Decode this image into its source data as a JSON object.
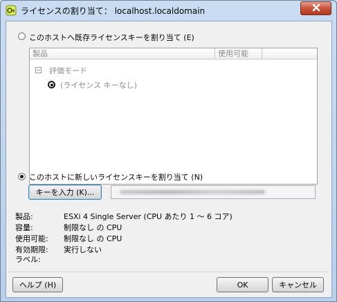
{
  "window": {
    "title": "ライセンスの割り当て： localhost.localdomain",
    "icons": {
      "app": "license-key-icon",
      "close": "close-icon"
    }
  },
  "existing_option": {
    "label": "このホストへ既存ライセンスキーを割り当て (E)",
    "selected": false
  },
  "license_table": {
    "columns": [
      "製品",
      "使用可能"
    ],
    "groups": [
      {
        "name": "評価モード",
        "expanded": true,
        "items": [
          {
            "label": "(ライセンス キーなし)",
            "selected": true
          }
        ]
      }
    ]
  },
  "new_option": {
    "label": "このホストに新しいライセンスキーを割り当て (N)",
    "selected": true,
    "enter_key_button": "キーを入力 (K)..."
  },
  "details": {
    "product_label": "製品:",
    "product_value": "ESXi 4 Single Server (CPU あたり 1 〜 6 コア)",
    "capacity_label": "容量:",
    "capacity_value": "制限なし の CPU",
    "available_label": "使用可能:",
    "available_value": "制限なし の CPU",
    "expiry_label": "有効期限:",
    "expiry_value": "実行しない",
    "labels_label": "ラベル:"
  },
  "buttons": {
    "help": "ヘルプ (H)",
    "ok": "OK",
    "cancel": "キャンセル"
  },
  "colors": {
    "title_bg": "#c9dcf2",
    "close_btn": "#c8533c"
  }
}
